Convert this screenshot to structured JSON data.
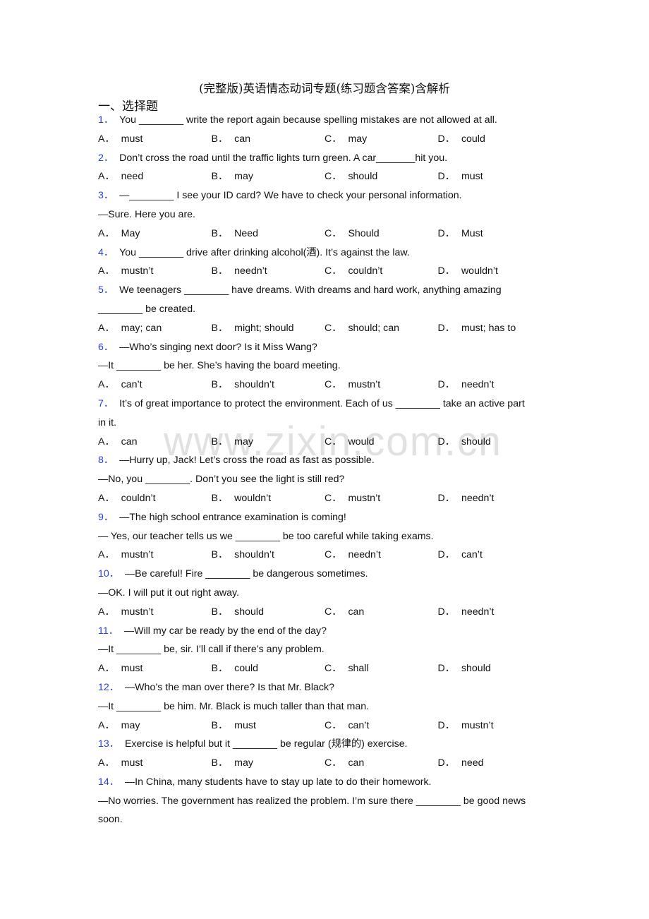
{
  "document": {
    "title": "(完整版)英语情态动词专题(练习题含答案)含解析",
    "section_heading": "一、选择题",
    "watermark": "www.zixin.com.cn",
    "accent_color": "#2b3fd6"
  },
  "questions": [
    {
      "number": "1．",
      "lines": [
        "You ________ write the report again because spelling mistakes are not allowed at all."
      ],
      "options": [
        {
          "letter": "A．",
          "text": "must"
        },
        {
          "letter": "B．",
          "text": "can"
        },
        {
          "letter": "C．",
          "text": "may"
        },
        {
          "letter": "D．",
          "text": "could"
        }
      ]
    },
    {
      "number": "2．",
      "lines": [
        "Don’t cross the road until the traffic lights turn green. A car_______hit you."
      ],
      "options": [
        {
          "letter": "A．",
          "text": "need"
        },
        {
          "letter": "B．",
          "text": "may"
        },
        {
          "letter": "C．",
          "text": "should"
        },
        {
          "letter": "D．",
          "text": "must"
        }
      ]
    },
    {
      "number": "3．",
      "lines": [
        "—________ I see your ID card? We have to check your personal information.",
        "—Sure. Here you are."
      ],
      "options": [
        {
          "letter": "A．",
          "text": "May"
        },
        {
          "letter": "B．",
          "text": "Need"
        },
        {
          "letter": "C．",
          "text": "Should"
        },
        {
          "letter": "D．",
          "text": "Must"
        }
      ]
    },
    {
      "number": "4．",
      "lines": [
        "You ________ drive after drinking alcohol(酒). It’s against the law."
      ],
      "options": [
        {
          "letter": "A．",
          "text": "mustn’t"
        },
        {
          "letter": "B．",
          "text": "needn’t"
        },
        {
          "letter": "C．",
          "text": "couldn’t"
        },
        {
          "letter": "D．",
          "text": "wouldn’t"
        }
      ]
    },
    {
      "number": "5．",
      "lines": [
        "We teenagers ________ have dreams. With dreams and hard work, anything amazing",
        "________ be created."
      ],
      "options": [
        {
          "letter": "A．",
          "text": "may; can"
        },
        {
          "letter": "B．",
          "text": "might; should"
        },
        {
          "letter": "C．",
          "text": "should; can"
        },
        {
          "letter": "D．",
          "text": "must; has to"
        }
      ]
    },
    {
      "number": "6．",
      "lines": [
        "—Who’s singing next door? Is it Miss Wang?",
        "—It ________ be her. She’s having the board meeting."
      ],
      "options": [
        {
          "letter": "A．",
          "text": "can’t"
        },
        {
          "letter": "B．",
          "text": "shouldn’t"
        },
        {
          "letter": "C．",
          "text": "mustn’t"
        },
        {
          "letter": "D．",
          "text": "needn’t"
        }
      ]
    },
    {
      "number": "7．",
      "lines": [
        "It’s of great importance to protect the environment. Each of us ________ take an active part",
        "in it."
      ],
      "options": [
        {
          "letter": "A．",
          "text": "can"
        },
        {
          "letter": "B．",
          "text": "may"
        },
        {
          "letter": "C．",
          "text": "would"
        },
        {
          "letter": "D．",
          "text": "should"
        }
      ]
    },
    {
      "number": "8．",
      "lines": [
        "—Hurry up, Jack! Let’s cross the road as fast as possible.",
        "—No, you ________. Don’t you see the light is still red?"
      ],
      "options": [
        {
          "letter": "A．",
          "text": "couldn’t"
        },
        {
          "letter": "B．",
          "text": "wouldn’t"
        },
        {
          "letter": "C．",
          "text": "mustn’t"
        },
        {
          "letter": "D．",
          "text": "needn’t"
        }
      ]
    },
    {
      "number": "9．",
      "lines": [
        "—The high school entrance examination is coming!",
        "— Yes, our teacher tells us we ________ be too careful while taking exams."
      ],
      "options": [
        {
          "letter": "A．",
          "text": "mustn’t"
        },
        {
          "letter": "B．",
          "text": "shouldn’t"
        },
        {
          "letter": "C．",
          "text": "needn’t"
        },
        {
          "letter": "D．",
          "text": "can’t"
        }
      ]
    },
    {
      "number": "10．",
      "lines": [
        "—Be careful! Fire ________ be dangerous sometimes.",
        "—OK. I will put it out right away."
      ],
      "options": [
        {
          "letter": "A．",
          "text": "mustn’t"
        },
        {
          "letter": "B．",
          "text": "should"
        },
        {
          "letter": "C．",
          "text": "can"
        },
        {
          "letter": "D．",
          "text": "needn’t"
        }
      ]
    },
    {
      "number": "11．",
      "lines": [
        "—Will my car be ready by the end of the day?",
        "—It ________ be, sir. I’ll call if there’s any problem."
      ],
      "options": [
        {
          "letter": "A．",
          "text": "must"
        },
        {
          "letter": "B．",
          "text": "could"
        },
        {
          "letter": "C．",
          "text": "shall"
        },
        {
          "letter": "D．",
          "text": "should"
        }
      ]
    },
    {
      "number": "12．",
      "lines": [
        "—Who’s the man over there? Is that Mr. Black?",
        "—It ________ be him. Mr. Black is much taller than that man."
      ],
      "options": [
        {
          "letter": "A．",
          "text": "may"
        },
        {
          "letter": "B．",
          "text": "must"
        },
        {
          "letter": "C．",
          "text": "can’t"
        },
        {
          "letter": "D．",
          "text": "mustn’t"
        }
      ]
    },
    {
      "number": "13．",
      "lines": [
        "Exercise is helpful but it ________ be regular (规律的) exercise."
      ],
      "options": [
        {
          "letter": "A．",
          "text": "must"
        },
        {
          "letter": "B．",
          "text": "may"
        },
        {
          "letter": "C．",
          "text": "can"
        },
        {
          "letter": "D．",
          "text": "need"
        }
      ]
    },
    {
      "number": "14．",
      "lines": [
        "—In China, many students have to stay up late to do their homework.",
        "—No worries. The government has realized the problem. I’m sure there ________ be good news",
        "soon."
      ],
      "options": []
    }
  ]
}
